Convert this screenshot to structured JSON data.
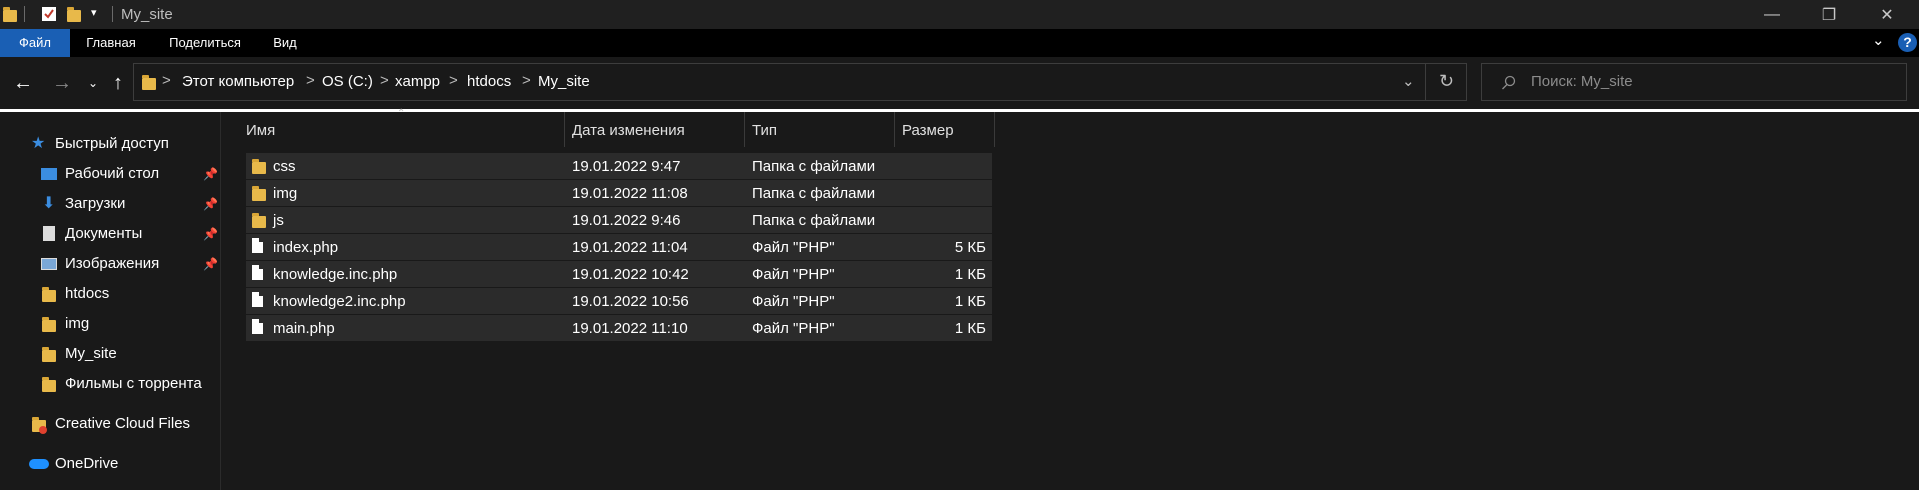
{
  "window": {
    "title": "My_site",
    "controls": {
      "minimize": "—",
      "maximize": "❐",
      "close": "✕"
    }
  },
  "ribbon": {
    "tabs": [
      "Файл",
      "Главная",
      "Поделиться",
      "Вид"
    ],
    "help": "?"
  },
  "address": {
    "crumbs": [
      "Этот компьютер",
      "OS (C:)",
      "xampp",
      "htdocs",
      "My_site"
    ],
    "separator": ">"
  },
  "search": {
    "placeholder": "Поиск: My_site"
  },
  "sidebar": {
    "quick_access": "Быстрый доступ",
    "items": [
      {
        "label": "Рабочий стол",
        "icon": "desktop-icon",
        "pinned": true
      },
      {
        "label": "Загрузки",
        "icon": "downloads-icon",
        "pinned": true
      },
      {
        "label": "Документы",
        "icon": "documents-icon",
        "pinned": true
      },
      {
        "label": "Изображения",
        "icon": "pictures-icon",
        "pinned": true
      },
      {
        "label": "htdocs",
        "icon": "folder-icon",
        "pinned": false
      },
      {
        "label": "img",
        "icon": "folder-icon",
        "pinned": false
      },
      {
        "label": "My_site",
        "icon": "folder-icon",
        "pinned": false
      },
      {
        "label": "Фильмы с торрента",
        "icon": "folder-icon",
        "pinned": false
      }
    ],
    "creative_cloud": "Creative Cloud Files",
    "onedrive": "OneDrive"
  },
  "file_list": {
    "columns": [
      "Имя",
      "Дата изменения",
      "Тип",
      "Размер"
    ],
    "rows": [
      {
        "name": "css",
        "date": "19.01.2022 9:47",
        "type": "Папка с файлами",
        "size": "",
        "kind": "folder"
      },
      {
        "name": "img",
        "date": "19.01.2022 11:08",
        "type": "Папка с файлами",
        "size": "",
        "kind": "folder"
      },
      {
        "name": "js",
        "date": "19.01.2022 9:46",
        "type": "Папка с файлами",
        "size": "",
        "kind": "folder"
      },
      {
        "name": "index.php",
        "date": "19.01.2022 11:04",
        "type": "Файл \"PHP\"",
        "size": "5 КБ",
        "kind": "file"
      },
      {
        "name": "knowledge.inc.php",
        "date": "19.01.2022 10:42",
        "type": "Файл \"PHP\"",
        "size": "1 КБ",
        "kind": "file"
      },
      {
        "name": "knowledge2.inc.php",
        "date": "19.01.2022 10:56",
        "type": "Файл \"PHP\"",
        "size": "1 КБ",
        "kind": "file"
      },
      {
        "name": "main.php",
        "date": "19.01.2022 11:10",
        "type": "Файл \"PHP\"",
        "size": "1 КБ",
        "kind": "file"
      }
    ]
  },
  "colors": {
    "accent": "#1a5fb4",
    "folder": "#e8b94a",
    "background": "#191919",
    "row": "#2b2b2b"
  }
}
